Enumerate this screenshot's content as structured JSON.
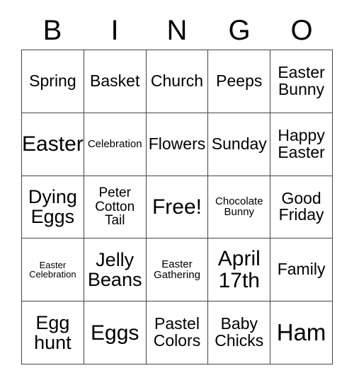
{
  "header": {
    "letters": [
      "B",
      "I",
      "N",
      "G",
      "O"
    ]
  },
  "grid": {
    "rows": [
      [
        {
          "text": "Spring",
          "size": "s-md"
        },
        {
          "text": "Basket",
          "size": "s-md"
        },
        {
          "text": "Church",
          "size": "s-md"
        },
        {
          "text": "Peeps",
          "size": "s-md"
        },
        {
          "text": "Easter\nBunny",
          "size": "s-md"
        }
      ],
      [
        {
          "text": "Easter",
          "size": "s-xl"
        },
        {
          "text": "Celebration",
          "size": "s-xs"
        },
        {
          "text": "Flowers",
          "size": "s-md"
        },
        {
          "text": "Sunday",
          "size": "s-md"
        },
        {
          "text": "Happy\nEaster",
          "size": "s-md"
        }
      ],
      [
        {
          "text": "Dying\nEggs",
          "size": "s-lg"
        },
        {
          "text": "Peter\nCotton\nTail",
          "size": "s-sm"
        },
        {
          "text": "Free!",
          "size": "s-xl"
        },
        {
          "text": "Chocolate\nBunny",
          "size": "s-xs"
        },
        {
          "text": "Good\nFriday",
          "size": "s-md"
        }
      ],
      [
        {
          "text": "Easter\nCelebration",
          "size": "s-xxs"
        },
        {
          "text": "Jelly\nBeans",
          "size": "s-lg"
        },
        {
          "text": "Easter\nGathering",
          "size": "s-xs"
        },
        {
          "text": "April\n17th",
          "size": "s-xl"
        },
        {
          "text": "Family",
          "size": "s-md"
        }
      ],
      [
        {
          "text": "Egg\nhunt",
          "size": "s-lg"
        },
        {
          "text": "Eggs",
          "size": "s-xl"
        },
        {
          "text": "Pastel\nColors",
          "size": "s-md"
        },
        {
          "text": "Baby\nChicks",
          "size": "s-md"
        },
        {
          "text": "Ham",
          "size": "s-xxl"
        }
      ]
    ]
  }
}
